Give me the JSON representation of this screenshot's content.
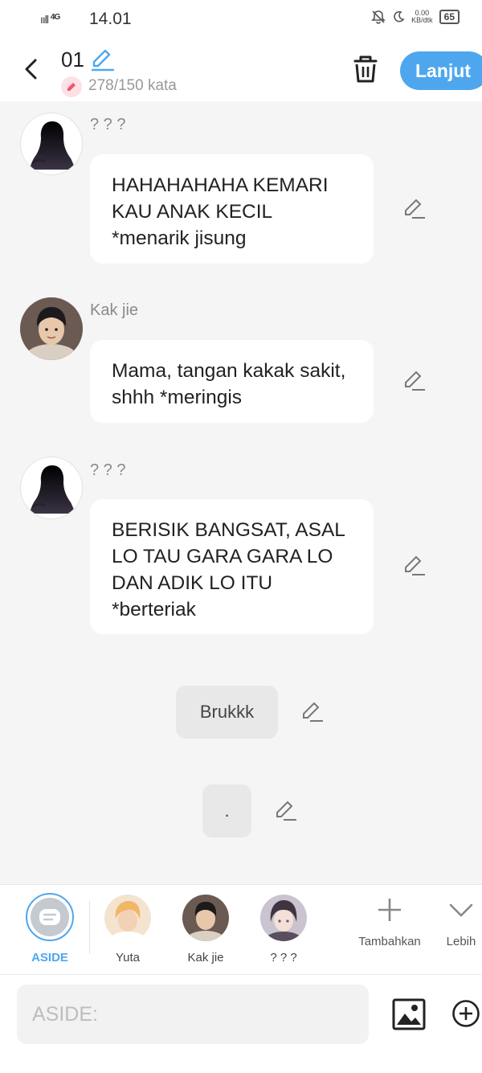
{
  "status_bar": {
    "signal": "ııll",
    "network": "4G",
    "time": "14.01",
    "speed_value": "0.00",
    "speed_unit": "KB/dtk",
    "battery": "65"
  },
  "header": {
    "title": "01",
    "word_count": "278/150 kata",
    "next_label": "Lanjut"
  },
  "messages": [
    {
      "speaker": "? ? ?",
      "text": "HAHAHAHAHA KEMARI KAU ANAK KECIL *menarik jisung"
    },
    {
      "speaker": "Kak jie",
      "text": "Mama, tangan kakak sakit, shhh *meringis"
    },
    {
      "speaker": "? ? ?",
      "text": "BERISIK BANGSAT, ASAL LO TAU GARA GARA LO DAN ADIK LO ITU *berteriak"
    }
  ],
  "narration": [
    {
      "text": "Brukkk"
    },
    {
      "text": "."
    }
  ],
  "characters": [
    {
      "label": "ASIDE",
      "active": true
    },
    {
      "label": "Yuta"
    },
    {
      "label": "Kak jie"
    },
    {
      "label": "? ? ?"
    }
  ],
  "tools": {
    "add_label": "Tambahkan",
    "more_label": "Lebih"
  },
  "input": {
    "placeholder": "ASIDE:"
  },
  "colors": {
    "accent": "#4ea7ee",
    "background": "#f5f5f5",
    "bubble": "#ffffff"
  }
}
